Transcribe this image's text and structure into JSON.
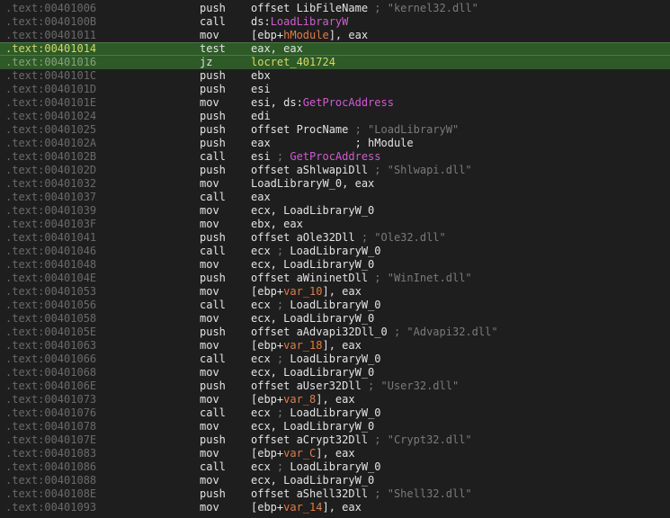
{
  "colors": {
    "background": "#1e1e1e",
    "highlight_row": "#2d5a27",
    "address": "#6a6a6a",
    "text": "#e3e3e3",
    "api_name": "#d25ad2",
    "local_var": "#e07b4a",
    "comment": "#7a7a7a"
  },
  "rows": [
    {
      "addr": ".text:00401006",
      "mn": "push",
      "ops": [
        [
          "t-name",
          "offset LibFileName "
        ],
        [
          "t-cmt",
          "; \"kernel32.dll\""
        ]
      ]
    },
    {
      "addr": ".text:0040100B",
      "mn": "call",
      "ops": [
        [
          "t-reg",
          "ds:"
        ],
        [
          "t-api",
          "LoadLibraryW"
        ]
      ]
    },
    {
      "addr": ".text:00401011",
      "mn": "mov",
      "ops": [
        [
          "t-reg",
          "[ebp+"
        ],
        [
          "t-var",
          "hModule"
        ],
        [
          "t-reg",
          "], eax"
        ]
      ]
    },
    {
      "addr": ".text:00401014",
      "mn": "test",
      "ops": [
        [
          "t-reg",
          "eax, eax"
        ]
      ],
      "hl": "hl"
    },
    {
      "addr": ".text:00401016",
      "mn": "jz",
      "ops": [
        [
          "t-code",
          "locret_401724"
        ]
      ],
      "hl": "hl2"
    },
    {
      "addr": ".text:0040101C",
      "mn": "push",
      "ops": [
        [
          "t-reg",
          "ebx"
        ]
      ]
    },
    {
      "addr": ".text:0040101D",
      "mn": "push",
      "ops": [
        [
          "t-reg",
          "esi"
        ]
      ]
    },
    {
      "addr": ".text:0040101E",
      "mn": "mov",
      "ops": [
        [
          "t-reg",
          "esi, ds:"
        ],
        [
          "t-api",
          "GetProcAddress"
        ]
      ]
    },
    {
      "addr": ".text:00401024",
      "mn": "push",
      "ops": [
        [
          "t-reg",
          "edi"
        ]
      ]
    },
    {
      "addr": ".text:00401025",
      "mn": "push",
      "ops": [
        [
          "t-name",
          "offset ProcName "
        ],
        [
          "t-cmt",
          "; \"LoadLibraryW\""
        ]
      ]
    },
    {
      "addr": ".text:0040102A",
      "mn": "push",
      "ops": [
        [
          "t-reg",
          "eax             "
        ],
        [
          "t-name",
          "; hModule"
        ]
      ]
    },
    {
      "addr": ".text:0040102B",
      "mn": "call",
      "ops": [
        [
          "t-reg",
          "esi "
        ],
        [
          "t-cmt",
          "; "
        ],
        [
          "t-api",
          "GetProcAddress"
        ]
      ]
    },
    {
      "addr": ".text:0040102D",
      "mn": "push",
      "ops": [
        [
          "t-name",
          "offset aShlwapiDll "
        ],
        [
          "t-cmt",
          "; \"Shlwapi.dll\""
        ]
      ]
    },
    {
      "addr": ".text:00401032",
      "mn": "mov",
      "ops": [
        [
          "t-name",
          "LoadLibraryW_0, eax"
        ]
      ]
    },
    {
      "addr": ".text:00401037",
      "mn": "call",
      "ops": [
        [
          "t-reg",
          "eax"
        ]
      ]
    },
    {
      "addr": ".text:00401039",
      "mn": "mov",
      "ops": [
        [
          "t-name",
          "ecx, LoadLibraryW_0"
        ]
      ]
    },
    {
      "addr": ".text:0040103F",
      "mn": "mov",
      "ops": [
        [
          "t-reg",
          "ebx, eax"
        ]
      ]
    },
    {
      "addr": ".text:00401041",
      "mn": "push",
      "ops": [
        [
          "t-name",
          "offset aOle32Dll "
        ],
        [
          "t-cmt",
          "; \"Ole32.dll\""
        ]
      ]
    },
    {
      "addr": ".text:00401046",
      "mn": "call",
      "ops": [
        [
          "t-reg",
          "ecx "
        ],
        [
          "t-cmt",
          "; "
        ],
        [
          "t-name",
          "LoadLibraryW_0"
        ]
      ]
    },
    {
      "addr": ".text:00401048",
      "mn": "mov",
      "ops": [
        [
          "t-name",
          "ecx, LoadLibraryW_0"
        ]
      ]
    },
    {
      "addr": ".text:0040104E",
      "mn": "push",
      "ops": [
        [
          "t-name",
          "offset aWininetDll "
        ],
        [
          "t-cmt",
          "; \"WinInet.dll\""
        ]
      ]
    },
    {
      "addr": ".text:00401053",
      "mn": "mov",
      "ops": [
        [
          "t-reg",
          "[ebp+"
        ],
        [
          "t-var",
          "var_10"
        ],
        [
          "t-reg",
          "], eax"
        ]
      ]
    },
    {
      "addr": ".text:00401056",
      "mn": "call",
      "ops": [
        [
          "t-reg",
          "ecx "
        ],
        [
          "t-cmt",
          "; "
        ],
        [
          "t-name",
          "LoadLibraryW_0"
        ]
      ]
    },
    {
      "addr": ".text:00401058",
      "mn": "mov",
      "ops": [
        [
          "t-name",
          "ecx, LoadLibraryW_0"
        ]
      ]
    },
    {
      "addr": ".text:0040105E",
      "mn": "push",
      "ops": [
        [
          "t-name",
          "offset aAdvapi32Dll_0 "
        ],
        [
          "t-cmt",
          "; \"Advapi32.dll\""
        ]
      ]
    },
    {
      "addr": ".text:00401063",
      "mn": "mov",
      "ops": [
        [
          "t-reg",
          "[ebp+"
        ],
        [
          "t-var",
          "var_18"
        ],
        [
          "t-reg",
          "], eax"
        ]
      ]
    },
    {
      "addr": ".text:00401066",
      "mn": "call",
      "ops": [
        [
          "t-reg",
          "ecx "
        ],
        [
          "t-cmt",
          "; "
        ],
        [
          "t-name",
          "LoadLibraryW_0"
        ]
      ]
    },
    {
      "addr": ".text:00401068",
      "mn": "mov",
      "ops": [
        [
          "t-name",
          "ecx, LoadLibraryW_0"
        ]
      ]
    },
    {
      "addr": ".text:0040106E",
      "mn": "push",
      "ops": [
        [
          "t-name",
          "offset aUser32Dll "
        ],
        [
          "t-cmt",
          "; \"User32.dll\""
        ]
      ]
    },
    {
      "addr": ".text:00401073",
      "mn": "mov",
      "ops": [
        [
          "t-reg",
          "[ebp+"
        ],
        [
          "t-var",
          "var_8"
        ],
        [
          "t-reg",
          "], eax"
        ]
      ]
    },
    {
      "addr": ".text:00401076",
      "mn": "call",
      "ops": [
        [
          "t-reg",
          "ecx "
        ],
        [
          "t-cmt",
          "; "
        ],
        [
          "t-name",
          "LoadLibraryW_0"
        ]
      ]
    },
    {
      "addr": ".text:00401078",
      "mn": "mov",
      "ops": [
        [
          "t-name",
          "ecx, LoadLibraryW_0"
        ]
      ]
    },
    {
      "addr": ".text:0040107E",
      "mn": "push",
      "ops": [
        [
          "t-name",
          "offset aCrypt32Dll "
        ],
        [
          "t-cmt",
          "; \"Crypt32.dll\""
        ]
      ]
    },
    {
      "addr": ".text:00401083",
      "mn": "mov",
      "ops": [
        [
          "t-reg",
          "[ebp+"
        ],
        [
          "t-var",
          "var_C"
        ],
        [
          "t-reg",
          "], eax"
        ]
      ]
    },
    {
      "addr": ".text:00401086",
      "mn": "call",
      "ops": [
        [
          "t-reg",
          "ecx "
        ],
        [
          "t-cmt",
          "; "
        ],
        [
          "t-name",
          "LoadLibraryW_0"
        ]
      ]
    },
    {
      "addr": ".text:00401088",
      "mn": "mov",
      "ops": [
        [
          "t-name",
          "ecx, LoadLibraryW_0"
        ]
      ]
    },
    {
      "addr": ".text:0040108E",
      "mn": "push",
      "ops": [
        [
          "t-name",
          "offset aShell32Dll "
        ],
        [
          "t-cmt",
          "; \"Shell32.dll\""
        ]
      ]
    },
    {
      "addr": ".text:00401093",
      "mn": "mov",
      "ops": [
        [
          "t-reg",
          "[ebp+"
        ],
        [
          "t-var",
          "var_14"
        ],
        [
          "t-reg",
          "], eax"
        ]
      ]
    }
  ]
}
